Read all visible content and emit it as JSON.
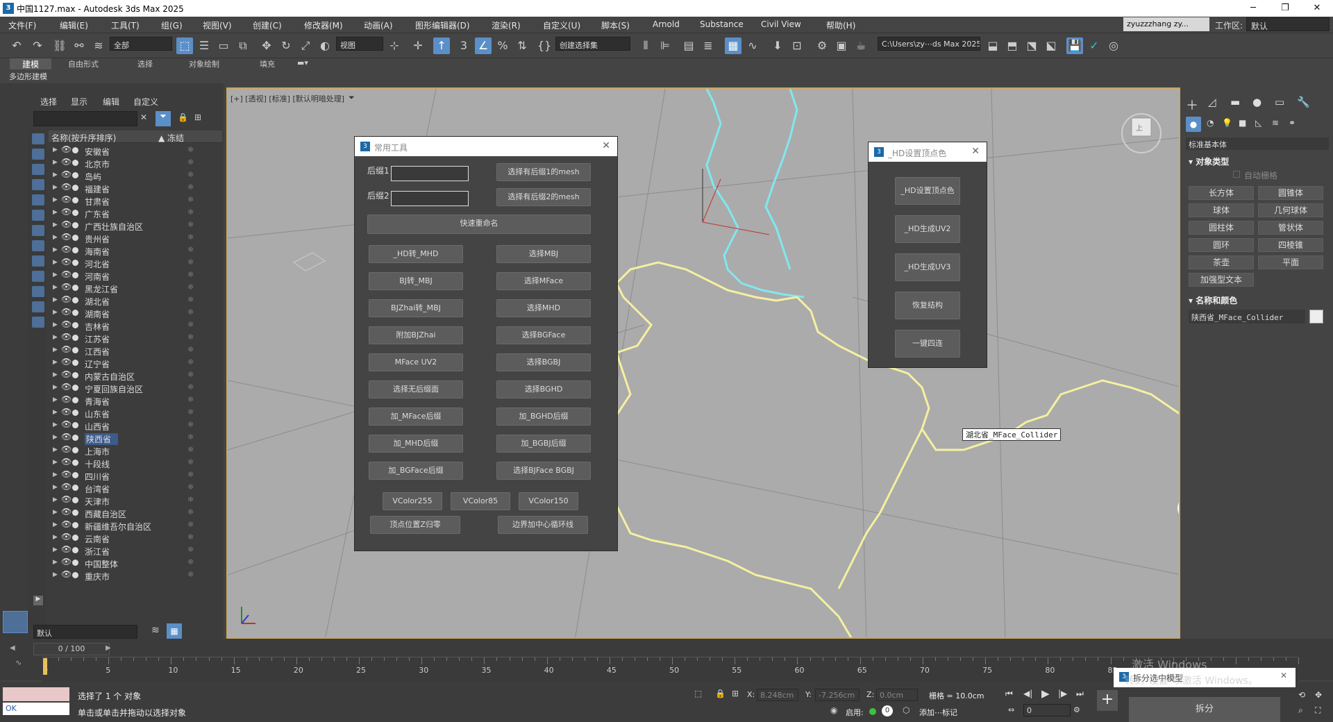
{
  "window": {
    "title": "中国1127.max - Autodesk 3ds Max 2025",
    "app_icon": "3ds-max-icon"
  },
  "menu": [
    "文件(F)",
    "编辑(E)",
    "工具(T)",
    "组(G)",
    "视图(V)",
    "创建(C)",
    "修改器(M)",
    "动画(A)",
    "图形编辑器(D)",
    "渲染(R)",
    "自定义(U)",
    "脚本(S)",
    "Arnold",
    "Substance",
    "Civil View",
    "帮助(H)"
  ],
  "user": "zyuzzzhang zy...",
  "workspace": {
    "label": "工作区:",
    "value": "默认"
  },
  "toolbar": {
    "filter_select": "全部",
    "view_select": "视图",
    "selection_set": "创建选择集",
    "path_select": "C:\\Users\\zy⋯ds Max 2025"
  },
  "ribbon": {
    "tabs": [
      "建模",
      "自由形式",
      "选择",
      "对象绘制",
      "填充"
    ],
    "sub": "多边形建模"
  },
  "explorer": {
    "tabs": [
      "选择",
      "显示",
      "编辑",
      "自定义"
    ],
    "col_name": "名称(按升序排序)",
    "col_freeze": "▲ 冻结",
    "rows": [
      "安徽省",
      "北京市",
      "岛屿",
      "福建省",
      "甘肃省",
      "广东省",
      "广西壮族自治区",
      "贵州省",
      "海南省",
      "河北省",
      "河南省",
      "黑龙江省",
      "湖北省",
      "湖南省",
      "吉林省",
      "江苏省",
      "江西省",
      "辽宁省",
      "内蒙古自治区",
      "宁夏回族自治区",
      "青海省",
      "山东省",
      "山西省",
      "陕西省",
      "上海市",
      "十段线",
      "四川省",
      "台湾省",
      "天津市",
      "西藏自治区",
      "新疆维吾尔自治区",
      "云南省",
      "浙江省",
      "中国整体",
      "重庆市"
    ],
    "selected": "陕西省",
    "layer": "默认"
  },
  "viewport": {
    "label": "[+] [透视] [标准] [默认明暗处理]",
    "object_tooltip": "湖北省_MFace_Collider",
    "axis_x": "x",
    "axis_y": "y",
    "axis_z": "z"
  },
  "tools_dialog": {
    "title": "常用工具",
    "suffix1_label": "后缀1",
    "suffix2_label": "后缀2",
    "select_suffix1": "选择有后缀1的mesh",
    "select_suffix2": "选择有后缀2的mesh",
    "quick_rename": "快速重命名",
    "left_buttons": [
      "_HD转_MHD",
      "BJ转_MBJ",
      "BJZhai转_MBJ",
      "附加BJZhai",
      "MFace UV2",
      "选择无后缀面",
      "加_MFace后缀",
      "加_MHD后缀",
      "加_BGFace后缀"
    ],
    "right_buttons": [
      "选择MBJ",
      "选择MFace",
      "选择MHD",
      "选择BGFace",
      "选择BGBJ",
      "选择BGHD",
      "加_BGHD后缀",
      "加_BGBJ后缀",
      "选择BJFace BGBJ"
    ],
    "vcolor": [
      "VColor255",
      "VColor85",
      "VColor150"
    ],
    "bottom": [
      "顶点位置Z归零",
      "边界加中心循环线"
    ]
  },
  "hd_dialog": {
    "title": "_HD设置顶点色",
    "buttons": [
      "_HD设置顶点色",
      "_HD生成UV2",
      "_HD生成UV3",
      "恢复结构",
      "一键四连"
    ]
  },
  "command_panel": {
    "category": "标准基本体",
    "object_type_head": "对象类型",
    "autogrid": "自动栅格",
    "primitives": [
      "长方体",
      "圆锥体",
      "球体",
      "几何球体",
      "圆柱体",
      "管状体",
      "圆环",
      "四棱锥",
      "茶壶",
      "平面",
      "加强型文本"
    ],
    "name_color_head": "名称和颜色",
    "object_name": "陕西省_MFace_Collider"
  },
  "timeline": {
    "frame": "0 / 100",
    "ticks": [
      "0",
      "5",
      "10",
      "15",
      "20",
      "25",
      "30",
      "35",
      "40",
      "45",
      "50",
      "55",
      "60",
      "65",
      "70",
      "75",
      "80",
      "85"
    ]
  },
  "status": {
    "selected": "选择了 1 个 对象",
    "hint": "单击或单击并拖动以选择对象",
    "ok": "OK",
    "x_label": "X:",
    "x_val": "8.248cm",
    "y_label": "Y:",
    "y_val": "-7.256cm",
    "z_label": "Z:",
    "z_val": "0.0cm",
    "grid": "栅格 = 10.0cm",
    "enable": "启用:",
    "add_key": "添加⋯标记",
    "frame_field": "0",
    "split_button": "拆分",
    "notification": "拆分选中模型",
    "watermark": "激活 Windows",
    "watermark_sub": "转到\"设置\"以激活 Windows。"
  },
  "colors": {
    "selection": "#3d5a8a",
    "accent_blue": "#5b8fc7",
    "viewport_bg": "#ababab",
    "cyan_border": "#7fe8f0",
    "yellow_border": "#f5f0a0"
  }
}
